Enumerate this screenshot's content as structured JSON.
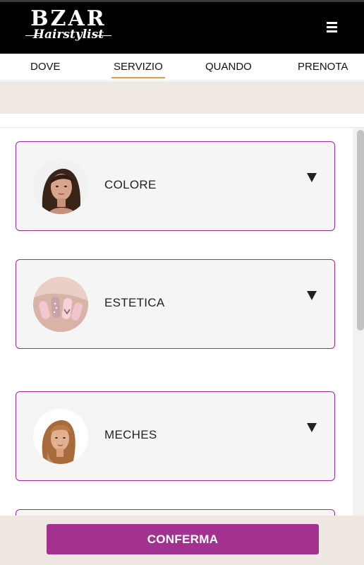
{
  "header": {
    "logo_main": "BZAR",
    "logo_sub": "Hairstylist",
    "menu_icon": "hamburger-menu-icon"
  },
  "tabs": [
    {
      "label": "DOVE",
      "active": false
    },
    {
      "label": "SERVIZIO",
      "active": true
    },
    {
      "label": "QUANDO",
      "active": false
    },
    {
      "label": "PRENOTA",
      "active": false
    }
  ],
  "services": [
    {
      "label": "COLORE",
      "icon": "triangle-down-icon"
    },
    {
      "label": "ESTETICA",
      "icon": "triangle-down-icon"
    },
    {
      "label": "MECHES",
      "icon": "triangle-down-icon"
    }
  ],
  "footer": {
    "confirm_label": "CONFERMA"
  },
  "colors": {
    "accent": "#a2318f",
    "tab_underline": "#e0a040",
    "band": "#f0e8e3"
  }
}
